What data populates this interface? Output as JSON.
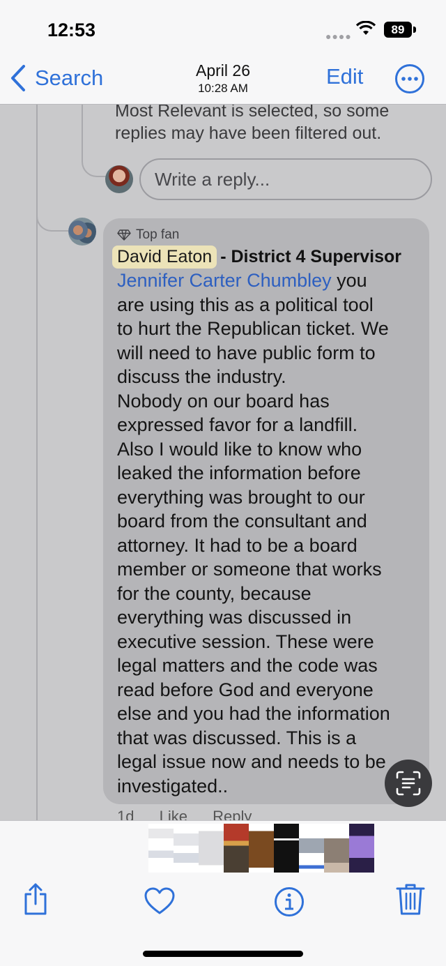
{
  "status_bar": {
    "time": "12:53",
    "battery": "89"
  },
  "nav": {
    "back_label": "Search",
    "date": "April 26",
    "time": "10:28 AM",
    "edit_label": "Edit"
  },
  "thread": {
    "filter_note_lines": [
      "Most Relevant is selected, so some",
      "replies may have been filtered out."
    ],
    "reply_placeholder": "Write a reply..."
  },
  "comment": {
    "badge": "Top fan",
    "author": "David Eaton",
    "author_title": "- District 4 Supervisor",
    "mention": "Jennifer Carter Chumbley",
    "first_line_rest": " you",
    "lines": [
      "are using this as a political tool",
      "to hurt the Republican ticket. We",
      "will need to have public form to",
      "discuss the industry.",
      "Nobody on our board has",
      "expressed favor for a landfill.",
      "Also I would like to know who",
      "leaked the information before",
      "everything was brought to our",
      "board from the consultant and",
      "attorney. It had to be a board",
      "member or someone that works",
      "for the county, because",
      "everything was discussed in",
      "executive session. These were",
      "legal matters and the code was",
      "read before God and everyone",
      "else and you had the information",
      "that was discussed. This is a",
      "legal issue now and needs to be",
      "investigated.."
    ],
    "age": "1d",
    "like_label": "Like",
    "reply_label": "Reply"
  },
  "colors": {
    "accent": "#2f71d9",
    "mention": "#2d5fc0",
    "highlight": "#ece3b8",
    "bubble": "#b5b5b8"
  },
  "toolbar": [
    "share-icon",
    "heart-icon",
    "info-icon",
    "trash-icon"
  ]
}
